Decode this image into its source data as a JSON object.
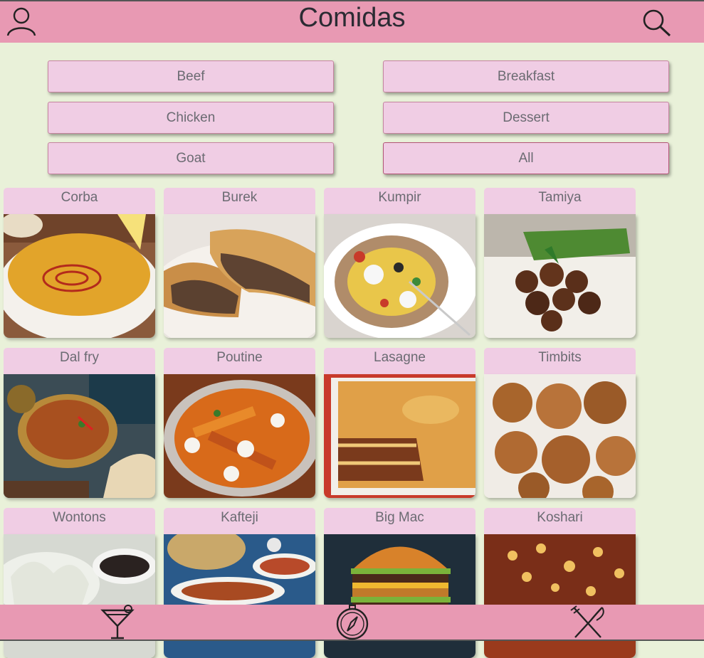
{
  "header": {
    "title": "Comidas",
    "icons": [
      "user-icon",
      "search-icon"
    ]
  },
  "categories": [
    {
      "label": "Beef"
    },
    {
      "label": "Breakfast"
    },
    {
      "label": "Chicken"
    },
    {
      "label": "Dessert"
    },
    {
      "label": "Goat"
    },
    {
      "label": "All",
      "selected": true
    }
  ],
  "meals": [
    {
      "name": "Corba"
    },
    {
      "name": "Burek"
    },
    {
      "name": "Kumpir"
    },
    {
      "name": "Tamiya"
    },
    {
      "name": "Dal fry"
    },
    {
      "name": "Poutine"
    },
    {
      "name": "Lasagne"
    },
    {
      "name": "Timbits"
    },
    {
      "name": "Wontons"
    },
    {
      "name": "Kafteji"
    },
    {
      "name": "Big Mac"
    },
    {
      "name": "Koshari"
    }
  ],
  "bottom_nav": {
    "icons": [
      "cocktail-icon",
      "compass-icon",
      "fork-knife-icon"
    ]
  },
  "colors": {
    "bar": "#e899b3",
    "button": "#f0cde4",
    "background": "#e9f1d9"
  }
}
